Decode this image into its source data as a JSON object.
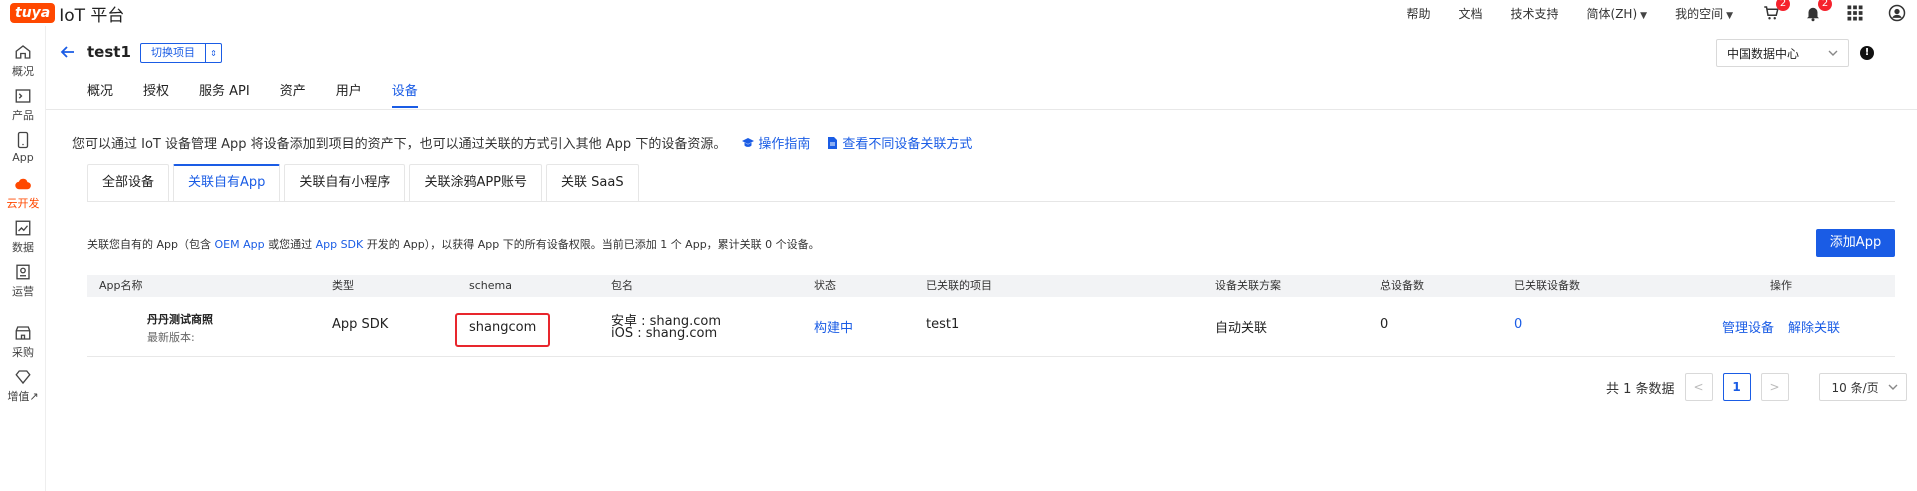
{
  "brand": {
    "logo_text": "tuya",
    "platform": "IoT 平台",
    "accent": "#ff4800",
    "primary": "#1a5ce5"
  },
  "topnav": {
    "links": [
      "帮助",
      "文档",
      "技术支持",
      "简体(ZH)",
      "我的空间"
    ],
    "cart_count": "2",
    "bell_count": "2"
  },
  "sidebar": {
    "items": [
      {
        "label": "概况",
        "icon": "home-icon"
      },
      {
        "label": "产品",
        "icon": "terminal-icon"
      },
      {
        "label": "App",
        "icon": "phone-icon"
      },
      {
        "label": "云开发",
        "icon": "cloud-icon",
        "active": true
      },
      {
        "label": "数据",
        "icon": "chart-icon"
      },
      {
        "label": "运营",
        "icon": "badge-icon"
      },
      {
        "label": "采购",
        "icon": "shop-icon"
      },
      {
        "label": "增值↗",
        "icon": "diamond-icon"
      }
    ]
  },
  "project": {
    "title": "test1",
    "switch_label": "切换项目",
    "region": "中国数据中心",
    "tabs": [
      "概况",
      "授权",
      "服务 API",
      "资产",
      "用户",
      "设备"
    ],
    "active_tab": "设备"
  },
  "intro": {
    "text": "您可以通过 IoT 设备管理 App 将设备添加到项目的资产下，也可以通过关联的方式引入其他 App 下的设备资源。",
    "guide_link": "操作指南",
    "compare_link": "查看不同设备关联方式"
  },
  "subtabs": {
    "items": [
      "全部设备",
      "关联自有App",
      "关联自有小程序",
      "关联涂鸦APP账号",
      "关联 SaaS"
    ],
    "active": "关联自有App"
  },
  "desc": {
    "p1": "关联您自有的 App（包含 ",
    "oem": "OEM App",
    "p2": " 或您通过 ",
    "sdk": "App SDK",
    "p3": " 开发的 App），以获得 App 下的所有设备权限。当前已添加 1 个 App，累计关联 0 个设备。",
    "add_button": "添加App"
  },
  "table": {
    "headers": [
      "App名称",
      "类型",
      "schema",
      "包名",
      "状态",
      "已关联的项目",
      "设备关联方案",
      "总设备数",
      "已关联设备数",
      "操作"
    ],
    "rows": [
      {
        "name": "丹丹测试商照",
        "version": "最新版本:",
        "type": "App SDK",
        "schema": "shangcom",
        "pkg_android": "安卓 : shang.com",
        "pkg_ios": "iOS : shang.com",
        "status": "构建中",
        "project": "test1",
        "scheme": "自动关联",
        "total": "0",
        "linked": "0",
        "action_manage": "管理设备",
        "action_unlink": "解除关联"
      }
    ]
  },
  "pagination": {
    "total_text": "共 1 条数据",
    "current": "1",
    "page_size": "10 条/页"
  }
}
